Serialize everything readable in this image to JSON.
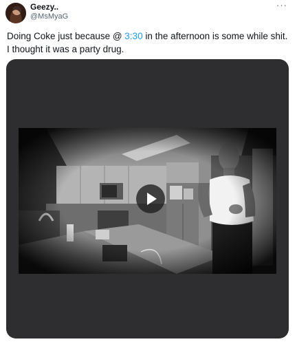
{
  "author": {
    "display_name": "Geezy..",
    "handle": "@MsMyaG",
    "avatar_icon": "profile-photo"
  },
  "menu": {
    "more_glyph": "···"
  },
  "tweet": {
    "text_before": "Doing Coke just because @ ",
    "mention": "3:30",
    "text_after": " in the afternoon is some while shit.  I thought it was a party drug."
  },
  "media": {
    "type": "video",
    "play_icon": "play-icon"
  },
  "colors": {
    "link": "#1d9bf0",
    "secondary_text": "#536471",
    "video_background": "#2e2e31"
  }
}
